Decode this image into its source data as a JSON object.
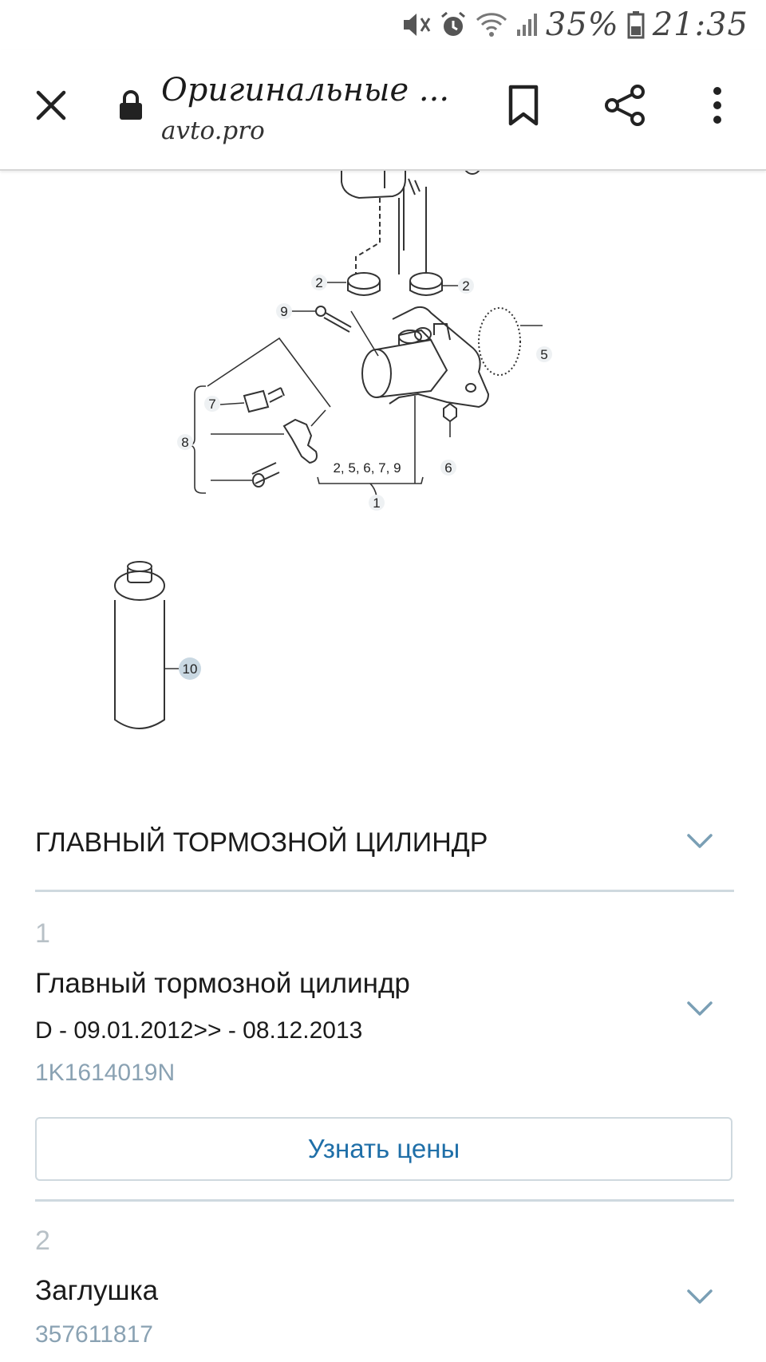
{
  "status_bar": {
    "battery": "35%",
    "time": "21:35",
    "icons": [
      "mute-icon",
      "alarm-icon",
      "wifi-icon",
      "signal-icon",
      "battery-icon"
    ]
  },
  "toolbar": {
    "title": "Оригинальные ...",
    "url": "avto.pro",
    "icons": [
      "close-icon",
      "lock-icon",
      "bookmark-icon",
      "share-icon",
      "more-icon"
    ]
  },
  "diagram": {
    "callouts": [
      "2",
      "2",
      "9",
      "5",
      "7",
      "8",
      "6",
      "2, 5, 6, 7, 9",
      "1",
      "10"
    ]
  },
  "section": {
    "title": "ГЛАВНЫЙ ТОРМОЗНОЙ ЦИЛИНДР"
  },
  "items": [
    {
      "number": "1",
      "name": "Главный тормозной цилиндр",
      "date": "D - 09.01.2012>> - 08.12.2013",
      "code": "1K1614019N",
      "button": "Узнать цены"
    },
    {
      "number": "2",
      "name": "Заглушка",
      "code": "357611817"
    }
  ],
  "colors": {
    "link": "#1f6fa8",
    "code": "#8aa2b3",
    "divider": "#cfd9df"
  }
}
